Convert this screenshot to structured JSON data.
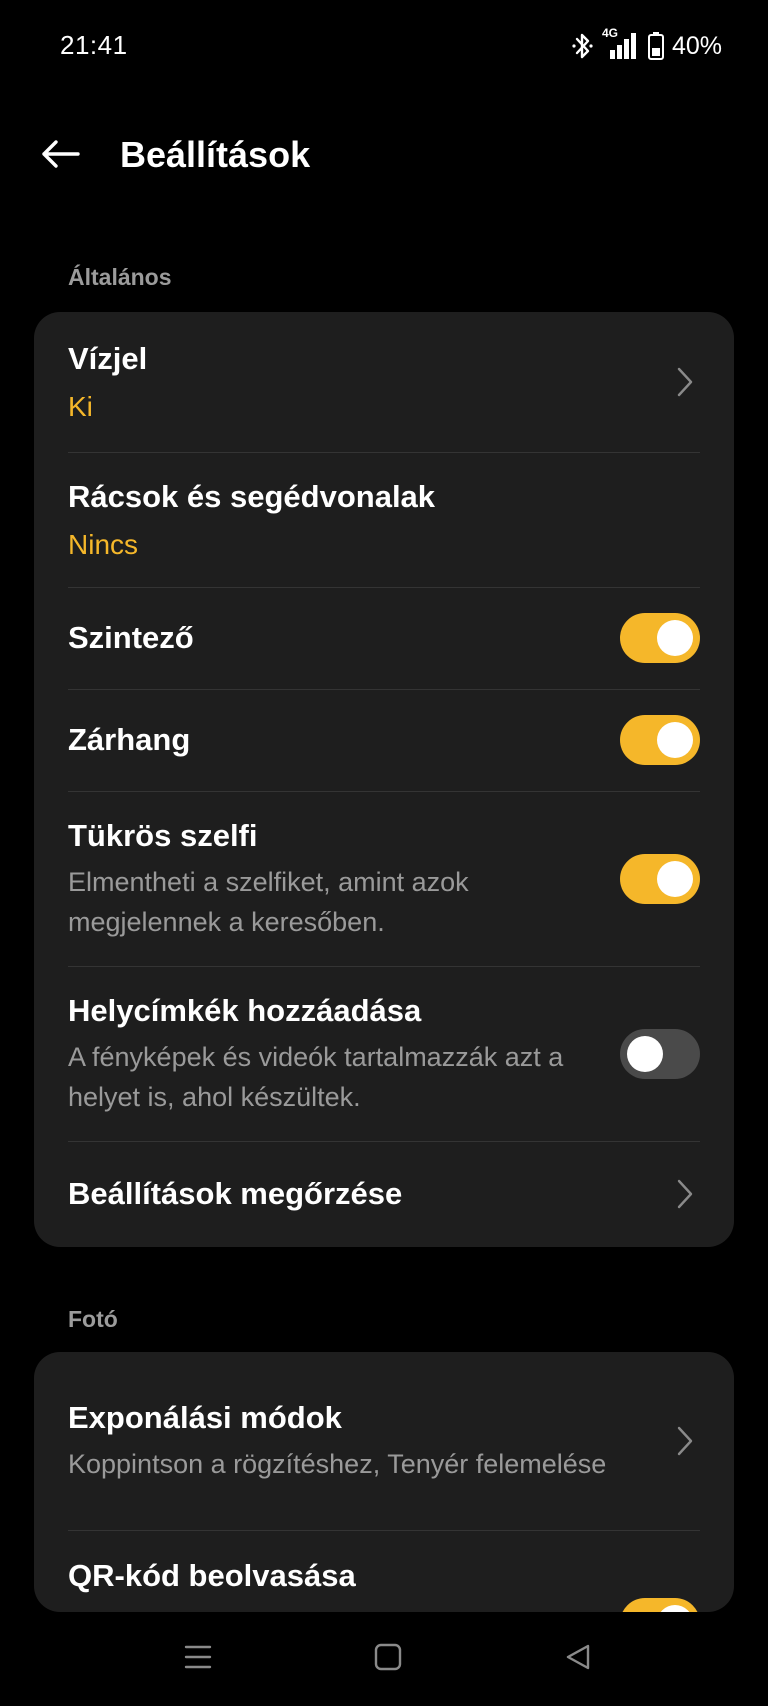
{
  "status_bar": {
    "time": "21:41",
    "network": "4G",
    "battery": "40%",
    "icons": [
      "bluetooth-icon",
      "signal-icon",
      "battery-icon"
    ]
  },
  "header": {
    "title": "Beállítások",
    "back_icon": "arrow-left-icon"
  },
  "sections": {
    "general": {
      "label": "Általános",
      "items": {
        "watermark": {
          "title": "Vízjel",
          "value": "Ki"
        },
        "grids": {
          "title": "Rácsok és segédvonalak",
          "value": "Nincs"
        },
        "level": {
          "title": "Szintező",
          "toggle": true
        },
        "shutter_sound": {
          "title": "Zárhang",
          "toggle": true
        },
        "mirror_selfie": {
          "title": "Tükrös szelfi",
          "desc": "Elmentheti a szelfiket, amint azok megjelennek a keresőben.",
          "toggle": true
        },
        "location_tags": {
          "title": "Helycímkék hozzáadása",
          "desc": "A fényképek és videók tartalmazzák azt a helyet is, ahol készültek.",
          "toggle": false
        },
        "keep_settings": {
          "title": "Beállítások megőrzése"
        }
      }
    },
    "photo": {
      "label": "Fotó",
      "items": {
        "shooting_modes": {
          "title": "Exponálási módok",
          "desc": "Koppintson a rögzítéshez, Tenyér felemelése"
        },
        "qr_scan": {
          "title": "QR-kód beolvasása",
          "toggle": true
        }
      }
    }
  },
  "nav_bar": {
    "icons": [
      "menu-icon",
      "home-icon",
      "back-triangle-icon"
    ]
  },
  "colors": {
    "accent": "#f5b72a",
    "card": "#1e1e1e",
    "background": "#000000",
    "secondary_text": "#9a9a9a"
  }
}
